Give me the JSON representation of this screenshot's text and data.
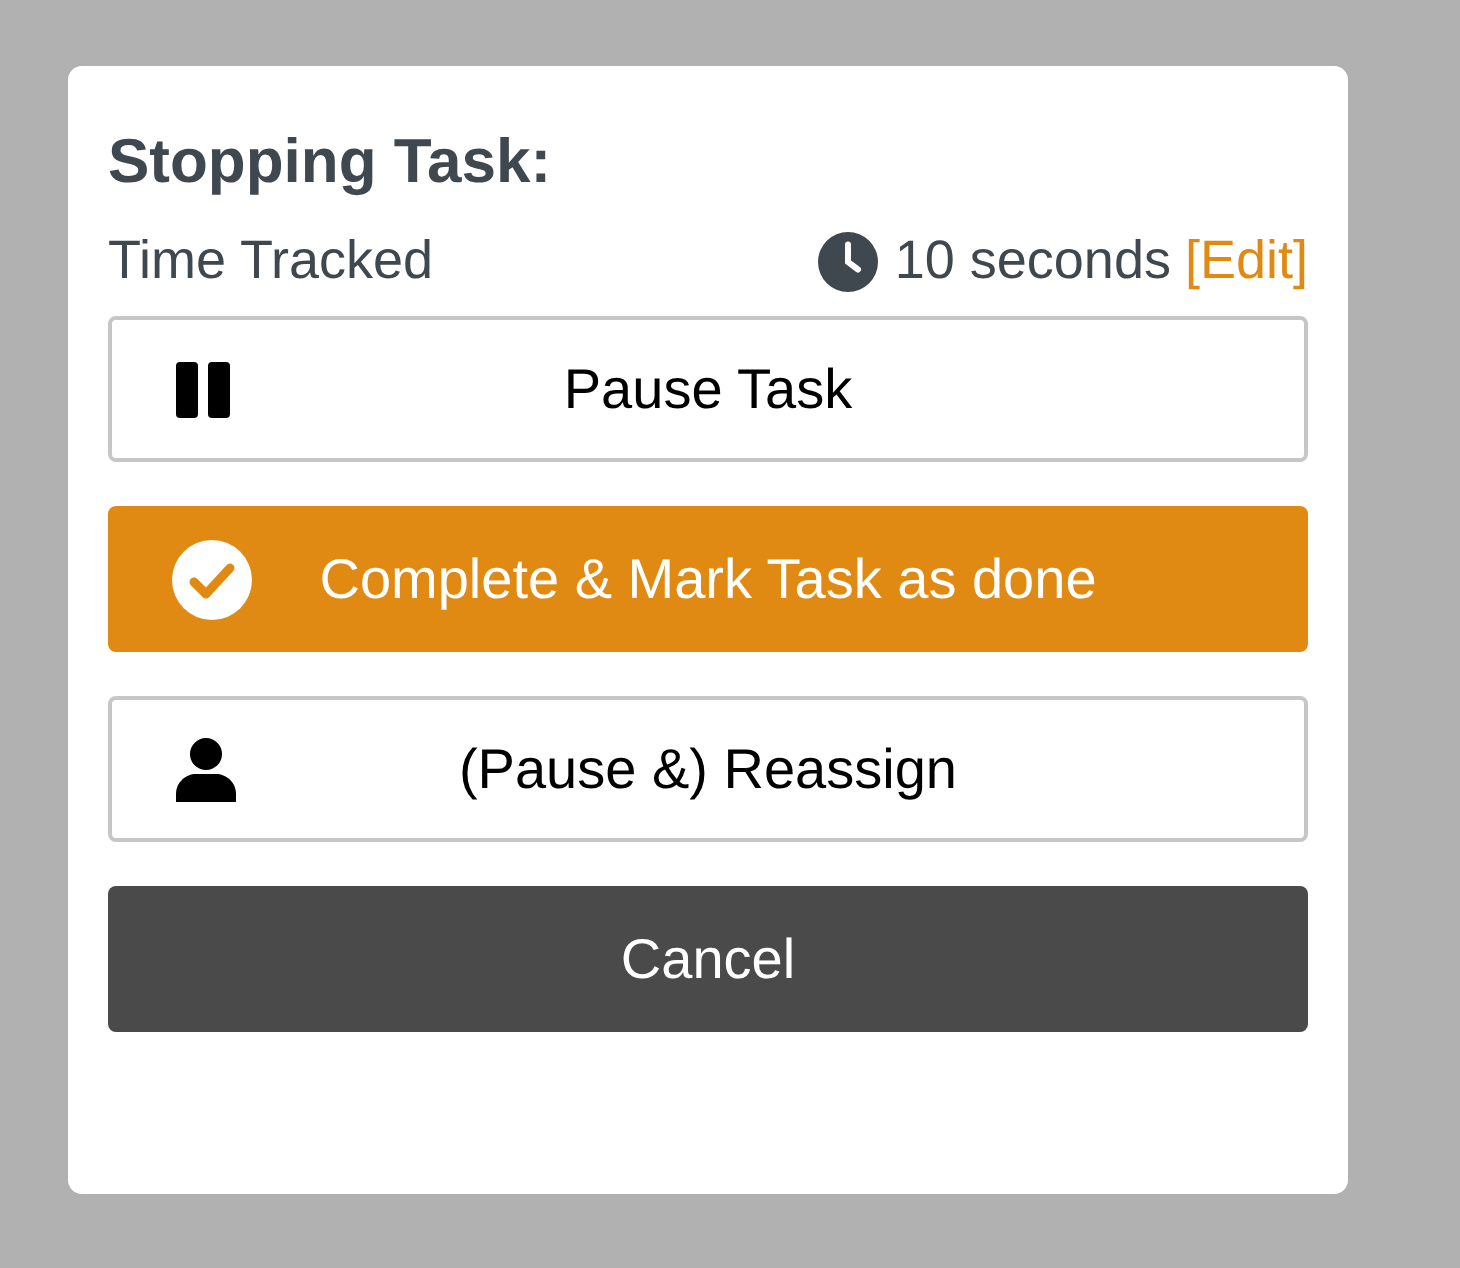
{
  "dialog": {
    "title": "Stopping Task:",
    "time": {
      "label": "Time Tracked",
      "value": "10 seconds",
      "edit": "[Edit]"
    },
    "buttons": [
      {
        "label": "Pause Task",
        "kind": "pause"
      },
      {
        "label": "Complete & Mark Task as done",
        "kind": "complete"
      },
      {
        "label": "(Pause &) Reassign",
        "kind": "reassign"
      },
      {
        "label": "Cancel",
        "kind": "cancel"
      }
    ]
  }
}
